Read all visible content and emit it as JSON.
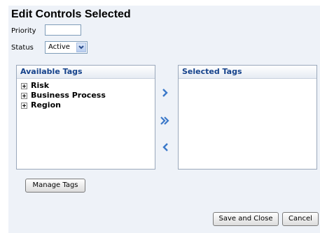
{
  "dialog": {
    "title": "Edit Controls Selected"
  },
  "fields": {
    "priority_label": "Priority",
    "priority_value": "",
    "status_label": "Status",
    "status_value": "Active"
  },
  "available": {
    "header": "Available Tags",
    "items": [
      "Risk",
      "Business Process",
      "Region"
    ]
  },
  "selected": {
    "header": "Selected Tags",
    "items": []
  },
  "buttons": {
    "manage_tags": "Manage Tags",
    "save_close": "Save and Close",
    "cancel": "Cancel"
  },
  "icons": {
    "move_right": "chevron-right-icon",
    "move_all_right": "double-chevron-right-icon",
    "move_left": "chevron-left-icon",
    "dropdown": "chevron-down-icon"
  },
  "colors": {
    "dialog_bg": "#eef2f8",
    "header_text": "#15428b",
    "arrow": "#3a78c9"
  }
}
